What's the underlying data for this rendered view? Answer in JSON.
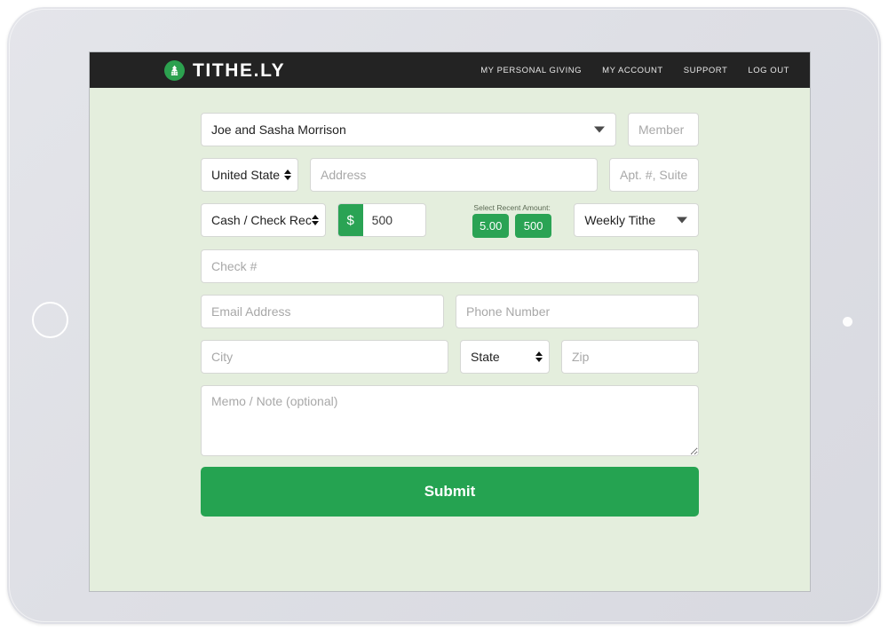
{
  "brand": {
    "name": "TITHE.LY",
    "logo_icon": "tree-icon",
    "logo_color": "#2ca14f"
  },
  "nav": {
    "links": [
      {
        "label": "MY PERSONAL GIVING"
      },
      {
        "label": "MY ACCOUNT"
      },
      {
        "label": "SUPPORT"
      },
      {
        "label": "LOG OUT"
      }
    ]
  },
  "form": {
    "donor_select": {
      "value": "Joe and Sasha Morrison",
      "icon": "chevron-down-icon"
    },
    "member_id": {
      "placeholder": "Member ID",
      "value": ""
    },
    "country_select": {
      "value": "United State",
      "icon": "up-down-arrows-icon"
    },
    "address": {
      "placeholder": "Address",
      "value": ""
    },
    "apt": {
      "placeholder": "Apt. #, Suite #,",
      "value": ""
    },
    "method_select": {
      "value": "Cash / Check Rec",
      "icon": "up-down-arrows-icon"
    },
    "amount": {
      "prefix": "$",
      "value": "500"
    },
    "recent": {
      "label": "Select Recent Amount:",
      "buttons": [
        {
          "label": "5.00"
        },
        {
          "label": "500"
        }
      ]
    },
    "frequency_select": {
      "value": "Weekly Tithe",
      "icon": "chevron-down-icon"
    },
    "check_number": {
      "placeholder": "Check #",
      "value": ""
    },
    "email": {
      "placeholder": "Email Address",
      "value": ""
    },
    "phone": {
      "placeholder": "Phone Number",
      "value": ""
    },
    "city": {
      "placeholder": "City",
      "value": ""
    },
    "state_select": {
      "value": "State",
      "icon": "up-down-arrows-icon"
    },
    "zip": {
      "placeholder": "Zip",
      "value": ""
    },
    "memo": {
      "placeholder": "Memo / Note (optional)",
      "value": ""
    },
    "submit": {
      "label": "Submit"
    }
  },
  "colors": {
    "accent_green": "#25a351",
    "screen_background": "#e4eedd",
    "topbar": "#232323"
  }
}
